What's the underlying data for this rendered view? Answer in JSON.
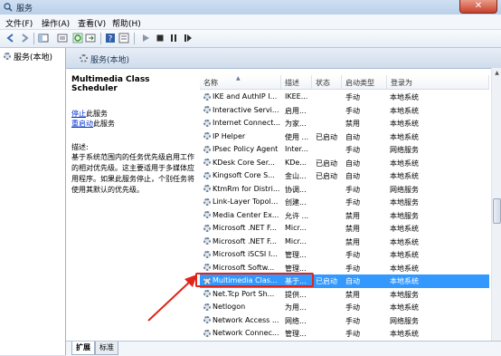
{
  "window": {
    "title": "服务",
    "close_glyph": "✕"
  },
  "menu": [
    "文件(F)",
    "操作(A)",
    "查看(V)",
    "帮助(H)"
  ],
  "toolbar_icons": [
    "back-icon",
    "forward-icon",
    "console-tree-icon",
    "show-hide-icon",
    "refresh-icon",
    "export-icon",
    "help-icon",
    "properties-icon",
    "start-service-icon",
    "stop-service-icon",
    "pause-service-icon",
    "restart-service-icon"
  ],
  "tree": {
    "root_label": "服务(本地)"
  },
  "main": {
    "header": "服务(本地)",
    "detail": {
      "service_name": "Multimedia Class Scheduler",
      "stop_link": "停止",
      "stop_suffix": "此服务",
      "restart_link": "重启动",
      "restart_suffix": "此服务",
      "desc_label": "描述:",
      "desc_text": "基于系统范围内的任务优先级启用工作的相对优先级。这主要适用于多媒体应用程序。如果此服务停止，个别任务将使用其默认的优先级。"
    },
    "columns": [
      "名称",
      "描述",
      "状态",
      "启动类型",
      "登录为"
    ],
    "rows": [
      {
        "name": "IKE and AuthIP I...",
        "desc": "IKEE...",
        "status": "",
        "startup": "手动",
        "logon": "本地系统"
      },
      {
        "name": "Interactive Servi...",
        "desc": "启用...",
        "status": "",
        "startup": "手动",
        "logon": "本地系统"
      },
      {
        "name": "Internet Connect...",
        "desc": "为家...",
        "status": "",
        "startup": "禁用",
        "logon": "本地系统"
      },
      {
        "name": "IP Helper",
        "desc": "使用 ...",
        "status": "已启动",
        "startup": "自动",
        "logon": "本地系统"
      },
      {
        "name": "IPsec Policy Agent",
        "desc": "Inter...",
        "status": "",
        "startup": "手动",
        "logon": "网络服务"
      },
      {
        "name": "KDesk Core Ser...",
        "desc": "KDe...",
        "status": "已启动",
        "startup": "自动",
        "logon": "本地系统"
      },
      {
        "name": "Kingsoft Core S...",
        "desc": "金山...",
        "status": "已启动",
        "startup": "自动",
        "logon": "本地系统"
      },
      {
        "name": "KtmRm for Distri...",
        "desc": "协调...",
        "status": "",
        "startup": "手动",
        "logon": "网络服务"
      },
      {
        "name": "Link-Layer Topol...",
        "desc": "创建...",
        "status": "",
        "startup": "手动",
        "logon": "本地服务"
      },
      {
        "name": "Media Center Ex...",
        "desc": "允许 ...",
        "status": "",
        "startup": "禁用",
        "logon": "本地服务"
      },
      {
        "name": "Microsoft .NET F...",
        "desc": "Micr...",
        "status": "",
        "startup": "禁用",
        "logon": "本地系统"
      },
      {
        "name": "Microsoft .NET F...",
        "desc": "Micr...",
        "status": "",
        "startup": "禁用",
        "logon": "本地系统"
      },
      {
        "name": "Microsoft iSCSI I...",
        "desc": "管理...",
        "status": "",
        "startup": "手动",
        "logon": "本地系统"
      },
      {
        "name": "Microsoft Softw...",
        "desc": "管理...",
        "status": "",
        "startup": "手动",
        "logon": "本地系统"
      },
      {
        "name": "Multimedia Clas...",
        "desc": "基于...",
        "status": "已启动",
        "startup": "自动",
        "logon": "本地系统"
      },
      {
        "name": "Net.Tcp Port Sh...",
        "desc": "提供...",
        "status": "",
        "startup": "禁用",
        "logon": "本地服务"
      },
      {
        "name": "Netlogon",
        "desc": "为用...",
        "status": "",
        "startup": "手动",
        "logon": "本地系统"
      },
      {
        "name": "Network Access ...",
        "desc": "网络...",
        "status": "",
        "startup": "手动",
        "logon": "网络服务"
      },
      {
        "name": "Network Connec...",
        "desc": "管理...",
        "status": "",
        "startup": "手动",
        "logon": "本地系统"
      }
    ],
    "selected_row_index": 14
  },
  "bottom_tabs": [
    "扩展",
    "标准"
  ],
  "colors": {
    "selection": "#3399ff",
    "annotation": "#e0251b"
  }
}
